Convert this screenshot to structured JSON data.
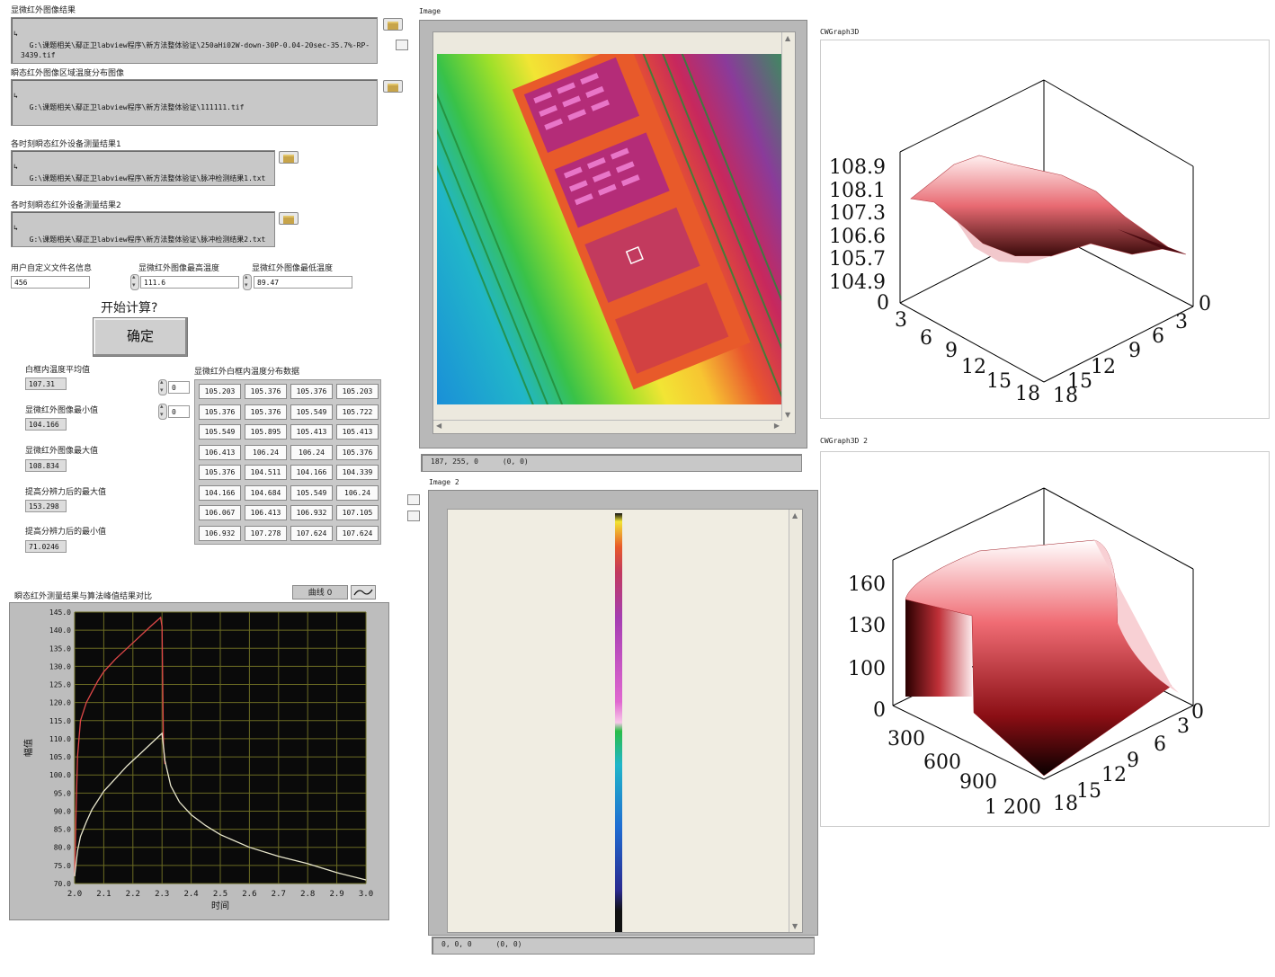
{
  "left_panel": {
    "file1": {
      "label": "显微红外图像结果",
      "path": "G:\\课题相关\\鄢正卫labview程序\\新方法整体验证\\250aHi02W-down-30P-0.04-20sec-35.7%-RP-3439.tif"
    },
    "file2": {
      "label": "瞬态红外图像区域温度分布图像",
      "path": "G:\\课题相关\\鄢正卫labview程序\\新方法整体验证\\111111.tif"
    },
    "file3": {
      "label": "各时刻瞬态红外设备测量结果1",
      "path": "G:\\课题相关\\鄢正卫labview程序\\新方法整体验证\\脉冲检测结果1.txt"
    },
    "file4": {
      "label": "各时刻瞬态红外设备测量结果2",
      "path": "G:\\课题相关\\鄢正卫labview程序\\新方法整体验证\\脉冲检测结果2.txt"
    },
    "user_filename": {
      "label": "用户自定义文件名信息",
      "value": "456"
    },
    "max_temp": {
      "label": "显微红外图像最高温度",
      "value": "111.6"
    },
    "min_temp": {
      "label": "显微红外图像最低温度",
      "value": "89.47"
    },
    "start_prompt": "开始计算?",
    "confirm_button": "确定",
    "avg_label": "白框内温度平均值",
    "avg_value": "107.31",
    "min_label": "显微红外图像最小值",
    "min_value": "104.166",
    "max_label": "显微红外图像最大值",
    "max_value": "108.834",
    "res_max_label": "提高分辨力后的最大值",
    "res_max_value": "153.298",
    "res_min_label": "提高分辨力后的最小值",
    "res_min_value": "71.0246",
    "index1": "0",
    "index2": "0",
    "table_label": "显微红外白框内温度分布数据",
    "table": [
      [
        "105.203",
        "105.376",
        "105.376",
        "105.203"
      ],
      [
        "105.376",
        "105.376",
        "105.549",
        "105.722"
      ],
      [
        "105.549",
        "105.895",
        "105.413",
        "105.413"
      ],
      [
        "106.413",
        "106.24",
        "106.24",
        "105.376"
      ],
      [
        "105.376",
        "104.511",
        "104.166",
        "104.339"
      ],
      [
        "104.166",
        "104.684",
        "105.549",
        "106.24"
      ],
      [
        "106.067",
        "106.413",
        "106.932",
        "107.105"
      ],
      [
        "106.932",
        "107.278",
        "107.624",
        "107.624"
      ]
    ]
  },
  "xy_graph": {
    "title": "瞬态红外测量结果与算法峰值结果对比",
    "legend_label": "曲线 0",
    "background": "#0a0a0a",
    "grid_color": "#6b6b23"
  },
  "chart_data": {
    "type": "line",
    "title": "瞬态红外测量结果与算法峰值结果对比",
    "xlabel": "时间",
    "ylabel": "幅值",
    "xlim": [
      2.0,
      3.0
    ],
    "ylim": [
      70.0,
      145.0
    ],
    "xticks": [
      "2.0",
      "2.1",
      "2.2",
      "2.3",
      "2.4",
      "2.5",
      "2.6",
      "2.7",
      "2.8",
      "2.9",
      "3.0"
    ],
    "yticks": [
      "145.0",
      "140.0",
      "135.0",
      "130.0",
      "125.0",
      "120.0",
      "115.0",
      "110.0",
      "105.0",
      "100.0",
      "95.0",
      "90.0",
      "85.0",
      "80.0",
      "75.0",
      "70.0"
    ],
    "grid": true,
    "series": [
      {
        "color": "#e04848",
        "x": [
          2.0,
          2.005,
          2.01,
          2.02,
          2.04,
          2.06,
          2.08,
          2.1,
          2.14,
          2.18,
          2.22,
          2.26,
          2.295,
          2.3,
          2.305,
          2.31
        ],
        "y": [
          72,
          90,
          105,
          115,
          120,
          123,
          126,
          128.5,
          132,
          135,
          138,
          141,
          143.5,
          141,
          108,
          103
        ]
      },
      {
        "color": "#e8e6cc",
        "x": [
          2.0,
          2.01,
          2.02,
          2.04,
          2.06,
          2.08,
          2.1,
          2.14,
          2.18,
          2.22,
          2.26,
          2.3,
          2.31,
          2.33,
          2.36,
          2.4,
          2.45,
          2.5,
          2.6,
          2.7,
          2.8,
          2.9,
          3.0
        ],
        "y": [
          72,
          79,
          83,
          87,
          90.5,
          93,
          95.5,
          99,
          102.5,
          105.5,
          108.5,
          111.5,
          104,
          97,
          92.5,
          89,
          86,
          83.5,
          80,
          77.5,
          75.5,
          73,
          71
        ]
      }
    ]
  },
  "image1": {
    "title": "Image",
    "coords": "187, 255, 0",
    "coords2": "(0, 0)"
  },
  "image2": {
    "title": "Image 2",
    "coords": "0, 0, 0",
    "coords2": "(0, 0)"
  },
  "graph3d_1": {
    "title": "CWGraph3D",
    "z_ticks": [
      "108.9",
      "108.1",
      "107.3",
      "106.6",
      "105.7",
      "104.9",
      "0"
    ],
    "x_ticks": [
      "3",
      "6",
      "9",
      "12",
      "15",
      "18"
    ],
    "y_ticks": [
      "0",
      "3",
      "6",
      "9",
      "12",
      "15",
      "18"
    ]
  },
  "graph3d_2": {
    "title": "CWGraph3D 2",
    "z_ticks": [
      "160",
      "130",
      "100",
      "0"
    ],
    "x_ticks": [
      "300",
      "600",
      "900",
      "1 200"
    ],
    "y_ticks": [
      "0",
      "3",
      "6",
      "9",
      "12",
      "15",
      "18"
    ]
  }
}
